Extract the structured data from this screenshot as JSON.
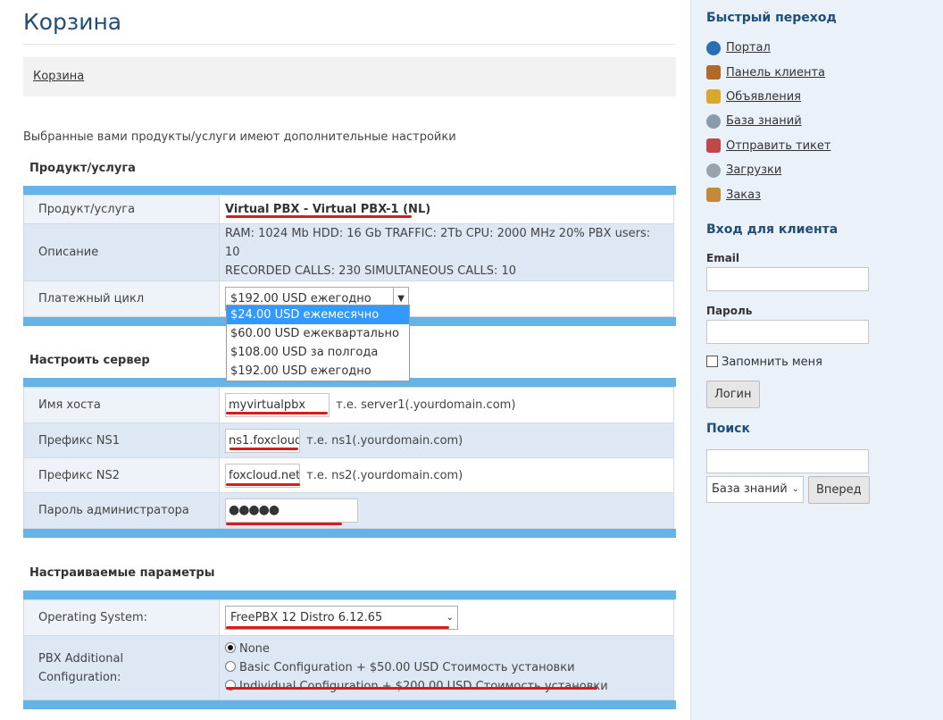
{
  "page": {
    "title": "Корзина",
    "breadcrumb": "Корзина",
    "note": "Выбранные вами продукты/услуги имеют дополнительные настройки"
  },
  "product_section": {
    "title": "Продукт/услуга",
    "product_label": "Продукт/услуга",
    "product_value": "Virtual PBX - Virtual PBX-1 (NL)",
    "description_label": "Описание",
    "description_line1": "RAM: 1024 Mb HDD: 16 Gb TRAFFIC: 2Tb CPU: 2000 MHz 20% PBX users: 10",
    "description_line2": "RECORDED CALLS: 230 SIMULTANEOUS CALLS: 10",
    "billing_label": "Платежный цикл",
    "billing_selected": "$192.00 USD ежегодно",
    "billing_options": [
      "$24.00 USD ежемесячно",
      "$60.00 USD ежеквартально",
      "$108.00 USD за полгода",
      "$192.00 USD ежегодно"
    ],
    "billing_highlighted_index": 0
  },
  "server_section": {
    "title": "Настроить сервер",
    "hostname_label": "Имя хоста",
    "hostname_value": "myvirtualpbx",
    "hostname_hint": "т.е. server1(.yourdomain.com)",
    "ns1_label": "Префикс NS1",
    "ns1_value": "ns1.foxcloud",
    "ns1_hint": "т.е. ns1(.yourdomain.com)",
    "ns2_label": "Префикс NS2",
    "ns2_value": "foxcloud.net",
    "ns2_hint": "т.е. ns2(.yourdomain.com)",
    "password_label": "Пароль администратора",
    "password_value": "●●●●●"
  },
  "config_section": {
    "title": "Настраиваемые параметры",
    "os_label": "Operating System:",
    "os_selected": "FreePBX 12 Distro 6.12.65",
    "pbx_label_line1": "PBX Additional",
    "pbx_label_line2": "Configuration:",
    "pbx_options": [
      "None",
      "Basic Configuration + $50.00 USD Стоимость установки",
      "Individual Configuration + $200.00 USD Стоимость установки"
    ],
    "pbx_selected_index": 0
  },
  "sidebar": {
    "quick_title": "Быстрый переход",
    "quick_links": [
      {
        "label": "Портал",
        "icon": "globe-icon",
        "color": "#2a6fb5"
      },
      {
        "label": "Панель клиента",
        "icon": "home-icon",
        "color": "#b06a2a"
      },
      {
        "label": "Объявления",
        "icon": "announcement-icon",
        "color": "#d9a72c"
      },
      {
        "label": "База знаний",
        "icon": "magnifier-icon",
        "color": "#8a9aa9"
      },
      {
        "label": "Отправить тикет",
        "icon": "ticket-icon",
        "color": "#c04848"
      },
      {
        "label": "Загрузки",
        "icon": "disc-icon",
        "color": "#9aa3ab"
      },
      {
        "label": "Заказ",
        "icon": "box-icon",
        "color": "#c28a3a"
      }
    ],
    "login_title": "Вход для клиента",
    "email_label": "Email",
    "password_label": "Пароль",
    "remember_label": "Запомнить меня",
    "login_button": "Логин",
    "search_title": "Поиск",
    "search_scope": "База знаний",
    "search_button": "Вперед"
  },
  "colors": {
    "accent_band": "#66b3e8",
    "title": "#1f4e79",
    "annotation_underline": "#d81c1c",
    "dropdown_highlight": "#3399ff"
  }
}
